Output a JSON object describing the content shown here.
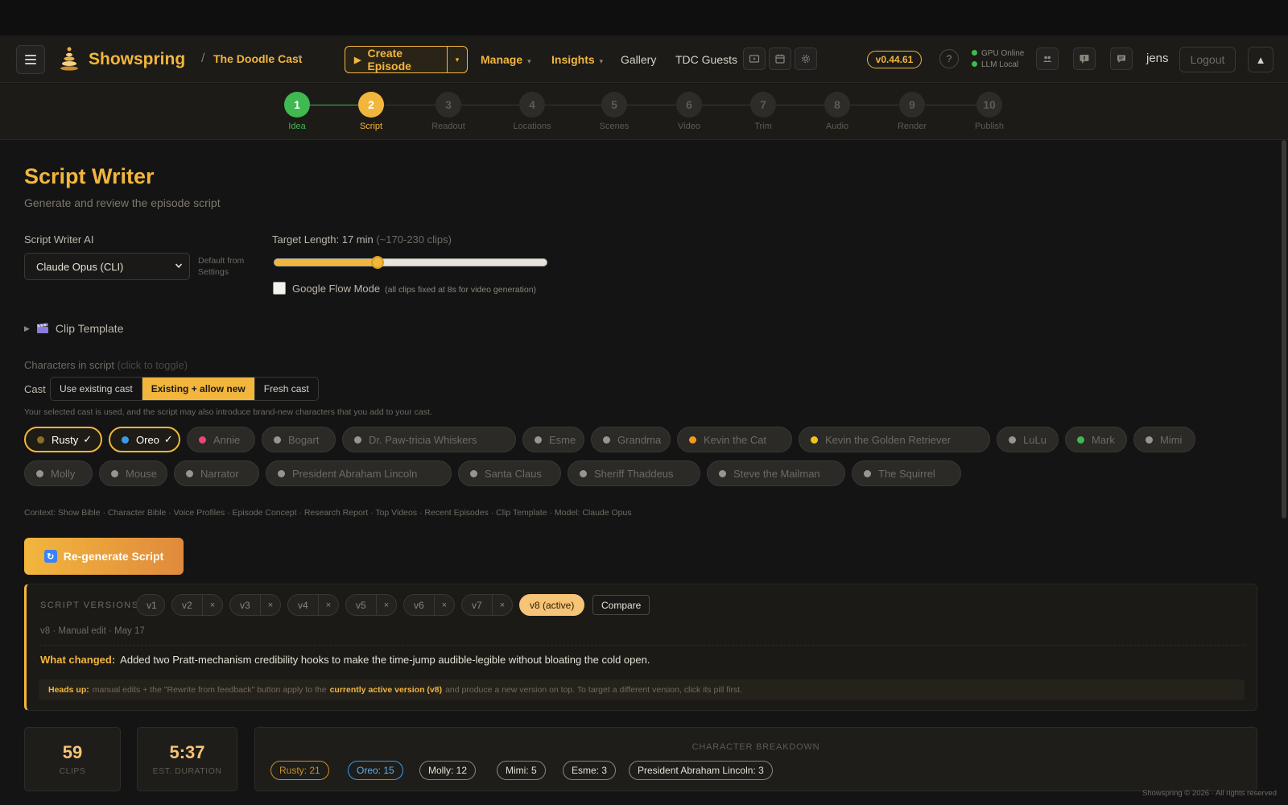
{
  "header": {
    "brand": "Showspring",
    "show_name": "The Doodle Cast",
    "create_episode": "Create Episode",
    "nav": {
      "manage": "Manage",
      "insights": "Insights",
      "gallery": "Gallery",
      "guests": "TDC Guests"
    },
    "version": "v0.44.61",
    "help": "?",
    "gpu_status": "GPU Online",
    "llm_status": "LLM Local",
    "user": "jens",
    "logout": "Logout"
  },
  "stepper": [
    {
      "num": "1",
      "label": "Idea",
      "state": "done"
    },
    {
      "num": "2",
      "label": "Script",
      "state": "active"
    },
    {
      "num": "3",
      "label": "Readout",
      "state": "pending"
    },
    {
      "num": "4",
      "label": "Locations",
      "state": "pending"
    },
    {
      "num": "5",
      "label": "Scenes",
      "state": "pending"
    },
    {
      "num": "6",
      "label": "Video",
      "state": "pending"
    },
    {
      "num": "7",
      "label": "Trim",
      "state": "pending"
    },
    {
      "num": "8",
      "label": "Audio",
      "state": "pending"
    },
    {
      "num": "9",
      "label": "Render",
      "state": "pending"
    },
    {
      "num": "10",
      "label": "Publish",
      "state": "pending"
    }
  ],
  "page": {
    "title": "Script Writer",
    "subtitle": "Generate and review the episode script",
    "ai_label": "Script Writer AI",
    "ai_value": "Claude Opus (CLI)",
    "ai_hint": "Default from Settings",
    "target_label": "Target Length: 17 min",
    "target_range": "(~170-230 clips)",
    "target_fraction": 0.38,
    "google_flow": "Google Flow Mode",
    "google_flow_note": "(all clips fixed at 8s for video generation)",
    "clip_template": "Clip Template",
    "chars_label": "Characters in script",
    "chars_hint": "(click to toggle)",
    "cast_label": "Cast",
    "cast_options": [
      "Use existing cast",
      "Existing + allow new",
      "Fresh cast"
    ],
    "cast_note": "Your selected cast is used, and the script may also introduce brand-new characters that you add to your cast.",
    "context": "Context: Show Bible · Character Bible · Voice Profiles · Episode Concept · Research Report · Top Videos · Recent Episodes · Clip Template · Model: Claude Opus",
    "regen": "Re-generate Script"
  },
  "characters": [
    {
      "name": "Rusty",
      "color": "#8b6d2a",
      "selected": true
    },
    {
      "name": "Oreo",
      "color": "#3b9ae8",
      "selected": true
    },
    {
      "name": "Annie",
      "color": "#e8457a",
      "selected": false
    },
    {
      "name": "Bogart",
      "color": "#9a958c",
      "selected": false
    },
    {
      "name": "Dr. Paw-tricia Whiskers",
      "color": "#9a958c",
      "selected": false
    },
    {
      "name": "Esme",
      "color": "#9a958c",
      "selected": false
    },
    {
      "name": "Grandma",
      "color": "#9a958c",
      "selected": false
    },
    {
      "name": "Kevin the Cat",
      "color": "#f29a1c",
      "selected": false
    },
    {
      "name": "Kevin the Golden Retriever",
      "color": "#f2c21c",
      "selected": false
    },
    {
      "name": "LuLu",
      "color": "#9a958c",
      "selected": false
    },
    {
      "name": "Mark",
      "color": "#3fb950",
      "selected": false
    },
    {
      "name": "Mimi",
      "color": "#9a958c",
      "selected": false
    },
    {
      "name": "Molly",
      "color": "#9a958c",
      "selected": false
    },
    {
      "name": "Mouse",
      "color": "#9a958c",
      "selected": false
    },
    {
      "name": "Narrator",
      "color": "#9a958c",
      "selected": false
    },
    {
      "name": "President Abraham Lincoln",
      "color": "#9a958c",
      "selected": false
    },
    {
      "name": "Santa Claus",
      "color": "#9a958c",
      "selected": false
    },
    {
      "name": "Sheriff Thaddeus",
      "color": "#9a958c",
      "selected": false
    },
    {
      "name": "Steve the Mailman",
      "color": "#9a958c",
      "selected": false
    },
    {
      "name": "The Squirrel",
      "color": "#9a958c",
      "selected": false
    }
  ],
  "versions": {
    "title": "SCRIPT VERSIONS",
    "pills": [
      "v1",
      "v2",
      "v3",
      "v4",
      "v5",
      "v6",
      "v7"
    ],
    "active": "v8 (active)",
    "compare": "Compare",
    "meta": "v8 · Manual edit · May 17",
    "what_changed_label": "What changed:",
    "what_changed": "Added two Pratt-mechanism credibility hooks to make the time-jump audible-legible without bloating the cold open.",
    "headsup_label": "Heads up:",
    "headsup_a": "manual edits + the \"Rewrite from feedback\" button apply to the",
    "headsup_hl": "currently active version (v8)",
    "headsup_b": "and produce a new version on top. To target a different version, click its pill first."
  },
  "stats": {
    "clips": "59",
    "clips_label": "CLIPS",
    "duration": "5:37",
    "duration_label": "EST. DURATION",
    "breakdown_title": "CHARACTER BREAKDOWN",
    "breakdown": [
      {
        "label": "Rusty: 21",
        "color": "#c8902a",
        "text": "#c8902a"
      },
      {
        "label": "Oreo: 15",
        "color": "#3b9ae8",
        "text": "#5fb0f0"
      },
      {
        "label": "Molly: 12",
        "color": "#8b867c",
        "text": "#e6e1d6"
      },
      {
        "label": "Mimi: 5",
        "color": "#8b867c",
        "text": "#e6e1d6"
      },
      {
        "label": "Esme: 3",
        "color": "#8b867c",
        "text": "#e6e1d6"
      },
      {
        "label": "President Abraham Lincoln: 3",
        "color": "#8b867c",
        "text": "#e6e1d6"
      }
    ]
  },
  "footer": "Showspring © 2026 · All rights reserved"
}
